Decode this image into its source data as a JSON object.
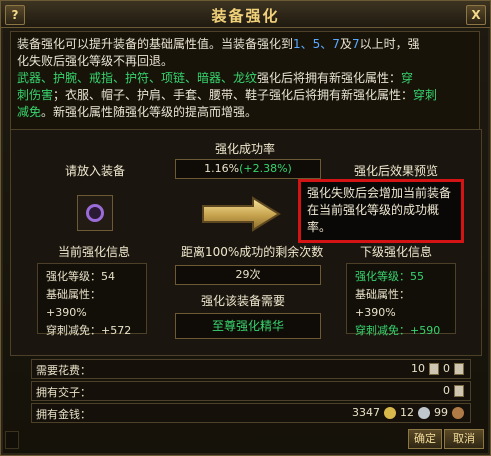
{
  "window": {
    "title": "装备强化",
    "help_label": "?",
    "close_label": "X"
  },
  "description": {
    "l1_a": "装备强化可以提升装备的基础属性值。当装备强化到",
    "l1_levels": "1、5、7",
    "l1_b": "及",
    "l1_level7": "7",
    "l1_c": "以上时，强",
    "l2": "化失败后强化等级不再回退。",
    "l3_items": "武器、护腕、戒指、护符、项链、暗器、龙纹",
    "l3_b": "强化后将拥有新强化属性：",
    "l3_attr": "穿",
    "l4_a": "刺伤害",
    "l4_b": "；衣服、帽子、护肩、手套、腰带、鞋子",
    "l4_c": "强化后将拥有新强化属性：",
    "l4_attr": "穿刺",
    "l5_attr": "减免",
    "l5_b": "。新强化属性随强化等级的提高而增强。"
  },
  "labels": {
    "place_equip": "请放入装备",
    "success_rate": "强化成功率",
    "preview": "强化后效果预览",
    "current_info": "当前强化信息",
    "remaining": "距离100%成功的剩余次数",
    "next_info": "下级强化信息",
    "need": "强化该装备需要"
  },
  "success_rate": {
    "base": "1.16%",
    "bonus": "(+2.38%)"
  },
  "tooltip": {
    "text": "强化失败后会增加当前装备在当前强化等级的成功概率。"
  },
  "current": [
    {
      "label": "强化等级：",
      "value": "54"
    },
    {
      "label": "基础属性：",
      "value": "+390%"
    },
    {
      "label": "穿刺减免：",
      "value": "+572"
    }
  ],
  "next": [
    {
      "label": "强化等级：",
      "value": "55"
    },
    {
      "label": "基础属性：",
      "value": "+390%"
    },
    {
      "label": "穿刺减免：",
      "value": "+590"
    }
  ],
  "remaining_count": "29次",
  "need_item": "至尊强化精华",
  "costs": {
    "cost_label": "需要花费：",
    "cost_value": "10",
    "cost_value2": "0",
    "token_label": "拥有交子：",
    "token_value": "0",
    "money_label": "拥有金钱：",
    "gold": "3347",
    "silver": "12",
    "copper": "99"
  },
  "buttons": {
    "ok": "确定",
    "cancel": "取消"
  }
}
